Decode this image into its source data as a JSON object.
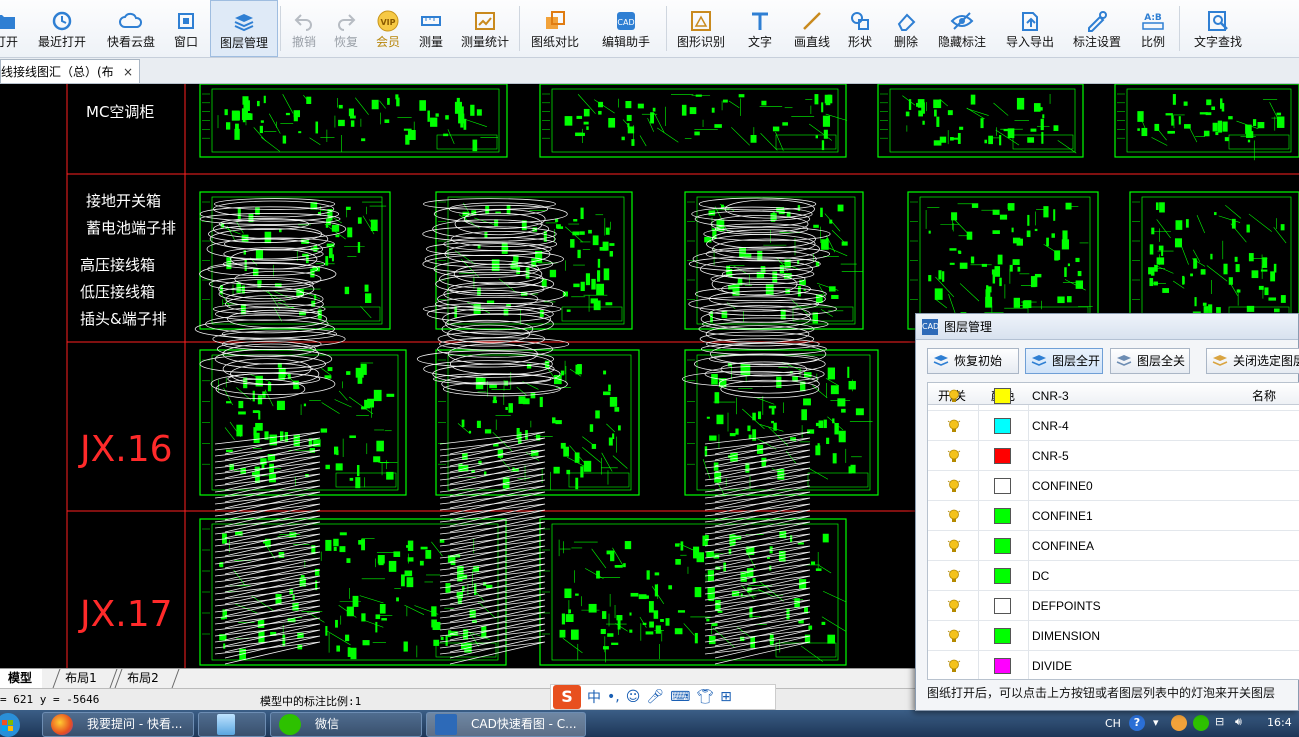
{
  "toolbar": {
    "items": [
      {
        "label": "打开",
        "icon": "open-folder-icon"
      },
      {
        "label": "最近打开",
        "icon": "recent-icon"
      },
      {
        "label": "快看云盘",
        "icon": "cloud-icon"
      },
      {
        "label": "窗口",
        "icon": "window-icon"
      },
      {
        "label": "图层管理",
        "icon": "layers-icon"
      },
      {
        "label": "撤销",
        "icon": "undo-icon"
      },
      {
        "label": "恢复",
        "icon": "redo-icon"
      },
      {
        "label": "会员",
        "icon": "vip-icon"
      },
      {
        "label": "测量",
        "icon": "measure-icon"
      },
      {
        "label": "测量统计",
        "icon": "measure-stats-icon"
      },
      {
        "label": "图纸对比",
        "icon": "compare-icon"
      },
      {
        "label": "编辑助手",
        "icon": "edit-assistant-icon"
      },
      {
        "label": "图形识别",
        "icon": "shape-recognize-icon"
      },
      {
        "label": "文字",
        "icon": "text-icon"
      },
      {
        "label": "画直线",
        "icon": "line-icon"
      },
      {
        "label": "形状",
        "icon": "shape-icon"
      },
      {
        "label": "删除",
        "icon": "eraser-icon"
      },
      {
        "label": "隐藏标注",
        "icon": "eye-icon"
      },
      {
        "label": "导入导出",
        "icon": "import-export-icon"
      },
      {
        "label": "标注设置",
        "icon": "annotation-settings-icon"
      },
      {
        "label": "比例",
        "icon": "scale-icon"
      },
      {
        "label": "文字查找",
        "icon": "text-search-icon"
      }
    ]
  },
  "doc_tab": {
    "title": "线接线图汇（总）(布",
    "close": "×"
  },
  "canvas": {
    "row_labels": [
      "MC空调柜",
      "接地开关箱",
      "蓄电池端子排",
      "高压接线箱",
      "低压接线箱",
      "插头&端子排",
      "JX.16",
      "JX.17"
    ],
    "colors": {
      "background": "#000000",
      "grid": "#ff2020",
      "drawing": "#00ff00",
      "annotation": "#ffffff"
    }
  },
  "layout_tabs": [
    "模型",
    "布局1",
    "布局2"
  ],
  "status": {
    "coords": "= 621 y = -5646",
    "scale": "模型中的标注比例:1"
  },
  "ime": {
    "mode": "中",
    "punct": "•,"
  },
  "taskbar": {
    "tasks": [
      "我要提问 - 快看...",
      "",
      "微信",
      "CAD快速看图 - C..."
    ],
    "tray_lang": "CH",
    "time": "16:4"
  },
  "layer_dialog": {
    "title": "图层管理",
    "buttons": [
      "恢复初始",
      "图层全开",
      "图层全关",
      "关闭选定图层"
    ],
    "columns": {
      "toggle": "开/关",
      "color": "颜色",
      "name": "名称"
    },
    "layers": [
      {
        "name": "CNR-3",
        "color": "#ffff00"
      },
      {
        "name": "CNR-4",
        "color": "#00ffff"
      },
      {
        "name": "CNR-5",
        "color": "#ff0000"
      },
      {
        "name": "CONFINE0",
        "color": "#ffffff"
      },
      {
        "name": "CONFINE1",
        "color": "#00ff00"
      },
      {
        "name": "CONFINEA",
        "color": "#00ff00"
      },
      {
        "name": "DC",
        "color": "#00ff00"
      },
      {
        "name": "DEFPOINTS",
        "color": "#ffffff"
      },
      {
        "name": "DIMENSION",
        "color": "#00ff00"
      },
      {
        "name": "DIVIDE",
        "color": "#ff00ff"
      }
    ],
    "hint": "图纸打开后，可以点击上方按钮或者图层列表中的灯泡来开关图层"
  }
}
